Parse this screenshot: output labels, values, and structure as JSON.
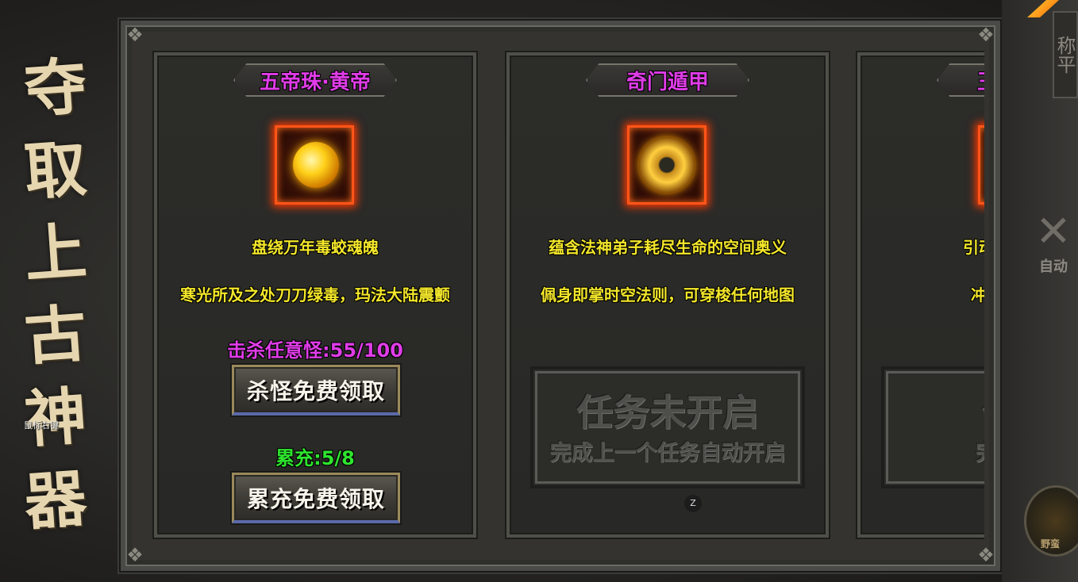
{
  "side_title": [
    "夺",
    "取",
    "上",
    "古",
    "神",
    "器"
  ],
  "mouse_hint": "鼠标右键",
  "cards": [
    {
      "title": "五帝珠·黄帝",
      "line1": "盘绕万年毒蛟魂魄",
      "line2": "寒光所及之处刀刀绿毒，玛法大陆震颤",
      "kill_progress_label": "击杀任意怪:55/100",
      "kill_button": "杀怪免费领取",
      "recharge_progress_label": "累充:5/8",
      "recharge_button": "累充免费领取",
      "colors": {
        "title": "#e03ce8",
        "kill_progress": "#e03ce8",
        "recharge_progress": "#2ee52e"
      }
    },
    {
      "title": "奇门遁甲",
      "line1": "蕴含法神弟子耗尽生命的空间奥义",
      "line2": "佩身即掌时空法则，可穿梭任何地图",
      "locked_title": "任务未开启",
      "locked_sub": "完成上一个任务自动开启"
    },
    {
      "title": "王之品质",
      "line1": "引动焚天之力横",
      "line2": "冲榜打宝一路",
      "locked_title": "任务",
      "locked_sub": "完成上一"
    }
  ],
  "z_badge": "Z",
  "right_panel": {
    "top_label": "称平",
    "auto_label": "自动",
    "wild_label": "野蛮"
  }
}
